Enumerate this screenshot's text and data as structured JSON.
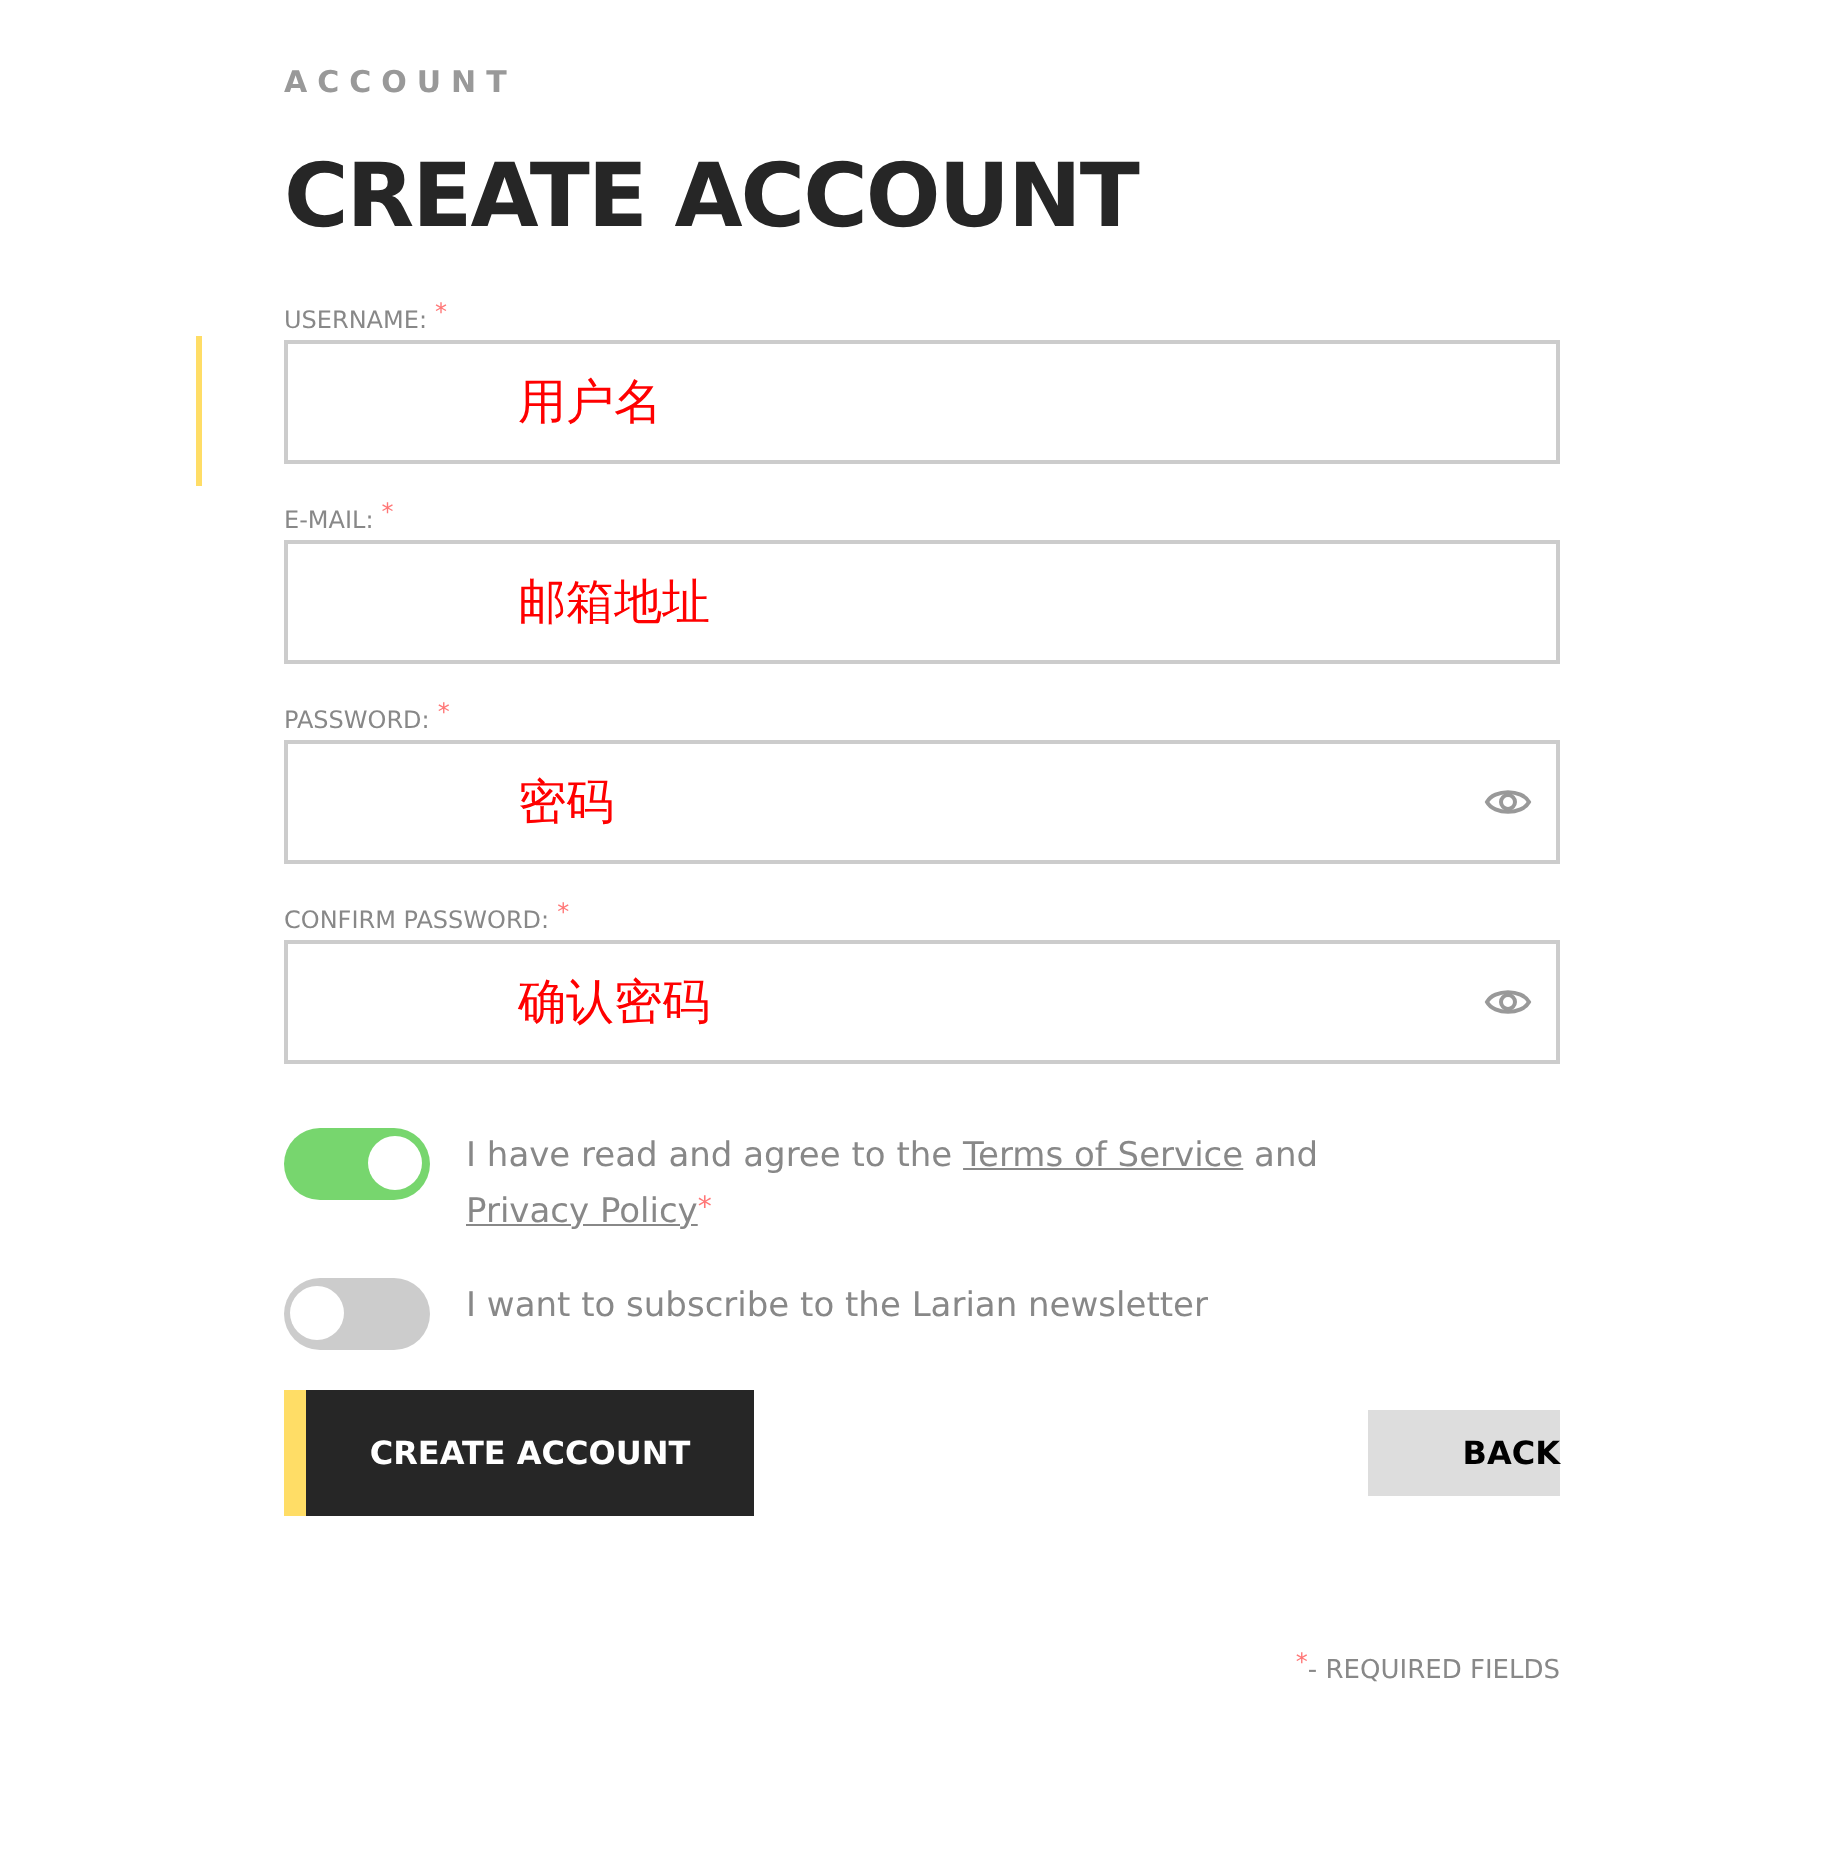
{
  "eyebrow": "ACCOUNT",
  "title": "CREATE ACCOUNT",
  "fields": [
    {
      "label": "USERNAME:",
      "required_mark": "*",
      "value": "用户名",
      "focused": true,
      "kind": "text"
    },
    {
      "label": "E-MAIL:",
      "required_mark": "*",
      "value": "邮箱地址",
      "focused": false,
      "kind": "text"
    },
    {
      "label": "PASSWORD:",
      "required_mark": "*",
      "value": "密码",
      "focused": false,
      "kind": "password"
    },
    {
      "label": "CONFIRM PASSWORD:",
      "required_mark": "*",
      "value": "确认密码",
      "focused": false,
      "kind": "password"
    }
  ],
  "toggles": [
    {
      "on": true,
      "parts": [
        {
          "kind": "text",
          "text": "I have read and agree to the "
        },
        {
          "kind": "link",
          "text": "Terms of Service"
        },
        {
          "kind": "text",
          "text": " and "
        },
        {
          "kind": "link",
          "text": "Privacy Policy"
        },
        {
          "kind": "mark",
          "text": "*"
        }
      ]
    },
    {
      "on": false,
      "parts": [
        {
          "kind": "text",
          "text": "I want to subscribe to the Larian newsletter"
        }
      ]
    }
  ],
  "buttons": {
    "primary": "CREATE ACCOUNT",
    "secondary": "BACK"
  },
  "footer": {
    "mark": "*",
    "text": "- REQUIRED FIELDS"
  }
}
